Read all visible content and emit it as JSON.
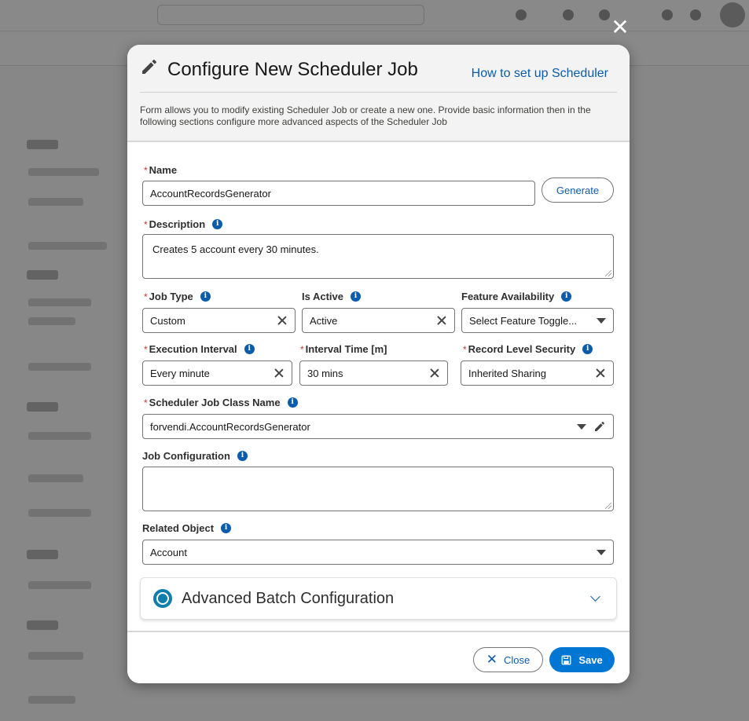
{
  "modal": {
    "title": "Configure New Scheduler Job",
    "help_link": "How to set up Scheduler",
    "description": "Form allows you to modify existing Scheduler Job or create a new one. Provide basic information then in the following sections configure more advanced aspects of the Scheduler Job",
    "close_icon": "close-icon",
    "title_icon": "pencil-icon"
  },
  "form": {
    "name": {
      "label": "Name",
      "required": "*",
      "value": "AccountRecordsGenerator"
    },
    "generate_button": "Generate",
    "description": {
      "label": "Description",
      "required": "*",
      "value": "Creates 5 account every 30 minutes."
    },
    "job_type": {
      "label": "Job Type",
      "required": "*",
      "value": "Custom"
    },
    "is_active": {
      "label": "Is Active",
      "value": "Active"
    },
    "feature_availability": {
      "label": "Feature Availability",
      "placeholder": "Select Feature Toggle..."
    },
    "execution_interval": {
      "label": "Execution Interval",
      "required": "*",
      "value": "Every minute"
    },
    "interval_time": {
      "label": "Interval Time [m]",
      "required": "*",
      "value": "30 mins"
    },
    "record_level_security": {
      "label": "Record Level Security",
      "required": "*",
      "value": "Inherited Sharing"
    },
    "class_name": {
      "label": "Scheduler Job Class Name",
      "required": "*",
      "value": "forvendi.AccountRecordsGenerator"
    },
    "job_configuration": {
      "label": "Job Configuration",
      "value": ""
    },
    "related_object": {
      "label": "Related Object",
      "value": "Account"
    },
    "info_glyph": "i"
  },
  "accordion": {
    "title": "Advanced Batch Configuration"
  },
  "footer": {
    "close_label": "Close",
    "save_label": "Save"
  },
  "colors": {
    "brand": "#0176d3",
    "link": "#0b5cab",
    "required": "#c23934"
  }
}
